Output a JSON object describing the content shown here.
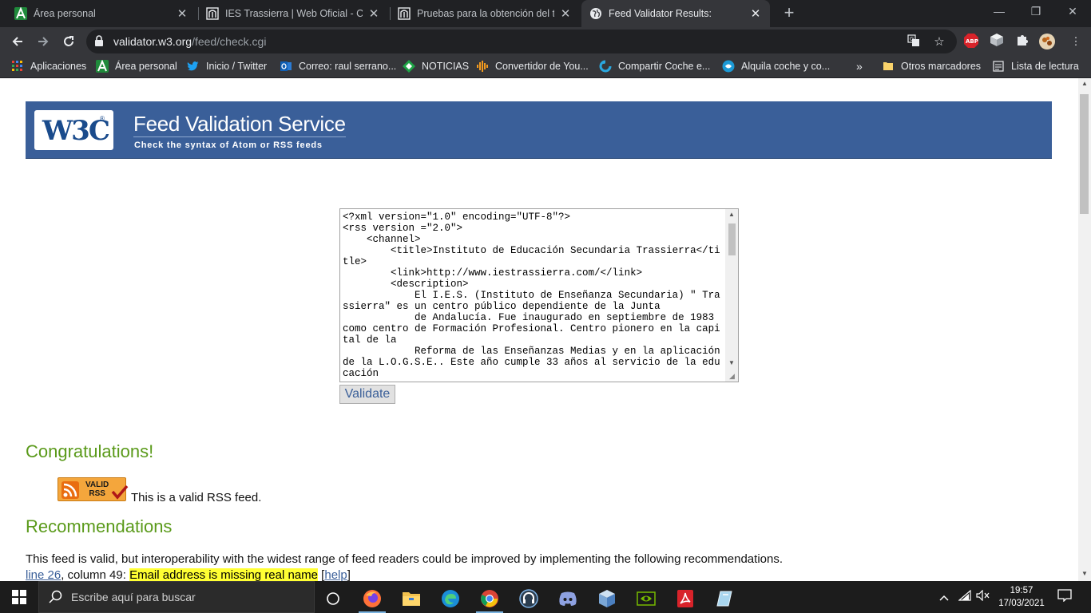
{
  "browser": {
    "tabs": [
      {
        "title": "Área personal",
        "icon": "moodle-a-icon",
        "active": false
      },
      {
        "title": "IES Trassierra | Web Oficial - Córdoba",
        "icon": "ies-trassierra-icon",
        "active": false
      },
      {
        "title": "Pruebas para la obtención del título",
        "icon": "ies-trassierra-icon",
        "active": false
      },
      {
        "title": "Feed Validator Results:",
        "icon": "globe-icon",
        "active": true
      }
    ],
    "url_host": "validator.w3.org",
    "url_path": "/feed/check.cgi",
    "bookmarks": [
      {
        "label": "Aplicaciones",
        "icon": "apps-grid-icon"
      },
      {
        "label": "Área personal",
        "icon": "moodle-a-icon"
      },
      {
        "label": "Inicio / Twitter",
        "icon": "twitter-icon"
      },
      {
        "label": "Correo: raul serrano...",
        "icon": "outlook-icon"
      },
      {
        "label": "NOTICIAS",
        "icon": "news-diamond-icon"
      },
      {
        "label": "Convertidor de You...",
        "icon": "audio-wave-icon"
      },
      {
        "label": "Compartir Coche e...",
        "icon": "blablacar-icon"
      },
      {
        "label": "Alquila coche y co...",
        "icon": "car-rental-icon"
      }
    ],
    "bookmarks_overflow": "»",
    "other_bookmarks": "Otros marcadores",
    "reading_list": "Lista de lectura"
  },
  "page": {
    "banner_logo": "W3C",
    "banner_title": "Feed Validation Service",
    "banner_subtitle": "Check the syntax of Atom or RSS feeds",
    "feed_source": "<?xml version=\"1.0\" encoding=\"UTF-8\"?>\n<rss version =\"2.0\">\n    <channel>\n        <title>Instituto de Educación Secundaria Trassierra</title>\n        <link>http://www.iestrassierra.com/</link>\n        <description>\n            El I.E.S. (Instituto de Enseñanza Secundaria) \" Trassierra\" es un centro público dependiente de la Junta\n            de Andalucía. Fue inaugurado en septiembre de 1983 como centro de Formación Profesional. Centro pionero en la capital de la\n            Reforma de las Enseñanzas Medias y en la aplicación de la L.O.G.S.E.. Este año cumple 33 años al servicio de la educación\n        </description>",
    "validate_label": "Validate",
    "congrats_heading": "Congratulations!",
    "badge_text_1": "VALID",
    "badge_text_2": "RSS",
    "valid_message": "This is a valid RSS feed.",
    "recommendations_heading": "Recommendations",
    "recommendations_intro": "This feed is valid, but interoperability with the widest range of feed readers could be improved by implementing the following recommendations.",
    "rec_line_link": "line 26",
    "rec_line_col": ", column 49: ",
    "rec_line_msg": "Email address is missing real name",
    "rec_line_help_open": " [",
    "rec_line_help": "help",
    "rec_line_help_close": "]"
  },
  "taskbar": {
    "search_placeholder": "Escribe aquí para buscar",
    "apps": [
      "task-view",
      "firefox",
      "file-explorer",
      "edge",
      "chrome",
      "headset-app",
      "discord",
      "virtualbox",
      "nvidia",
      "acrobat",
      "cube-app"
    ],
    "time": "19:57",
    "date": "17/03/2021"
  },
  "colors": {
    "banner_blue": "#3a5f99",
    "heading_green": "#5a9a1a",
    "highlight_yellow": "#ffff33",
    "chrome_dark": "#202124",
    "chrome_toolbar": "#35363a"
  }
}
